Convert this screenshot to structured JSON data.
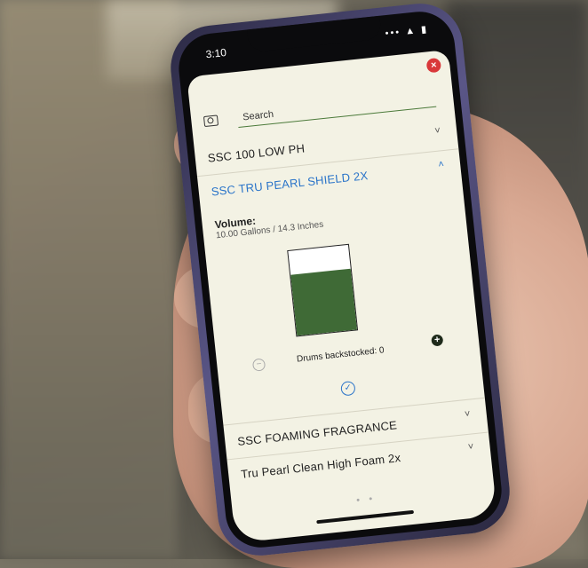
{
  "status": {
    "time": "3:10",
    "icons": "••• ▲ ▮"
  },
  "search": {
    "placeholder": "Search"
  },
  "products": [
    {
      "name": "SSC 100 LOW PH",
      "chevron": "˅"
    },
    {
      "name": "SSC TRU PEARL SHIELD 2X",
      "chevron": "˄"
    },
    {
      "name": "SSC FOAMING FRAGRANCE",
      "chevron": "˅"
    },
    {
      "name": "Tru Pearl Clean High Foam 2x",
      "chevron": "˅"
    }
  ],
  "detail": {
    "volume_label": "Volume:",
    "volume_value": "10.00 Gallons / 14.3 Inches",
    "tank_fill_fraction": 0.72,
    "drums_label": "Drums backstocked: 0"
  },
  "icons": {
    "close": "×",
    "minus": "−",
    "plus": "+",
    "confirm": "✓",
    "page_dots": "● ●"
  },
  "colors": {
    "accent": "#2a74c9",
    "fill": "#3f6a36",
    "close": "#d9383a",
    "sheet": "#f3f2e4"
  }
}
